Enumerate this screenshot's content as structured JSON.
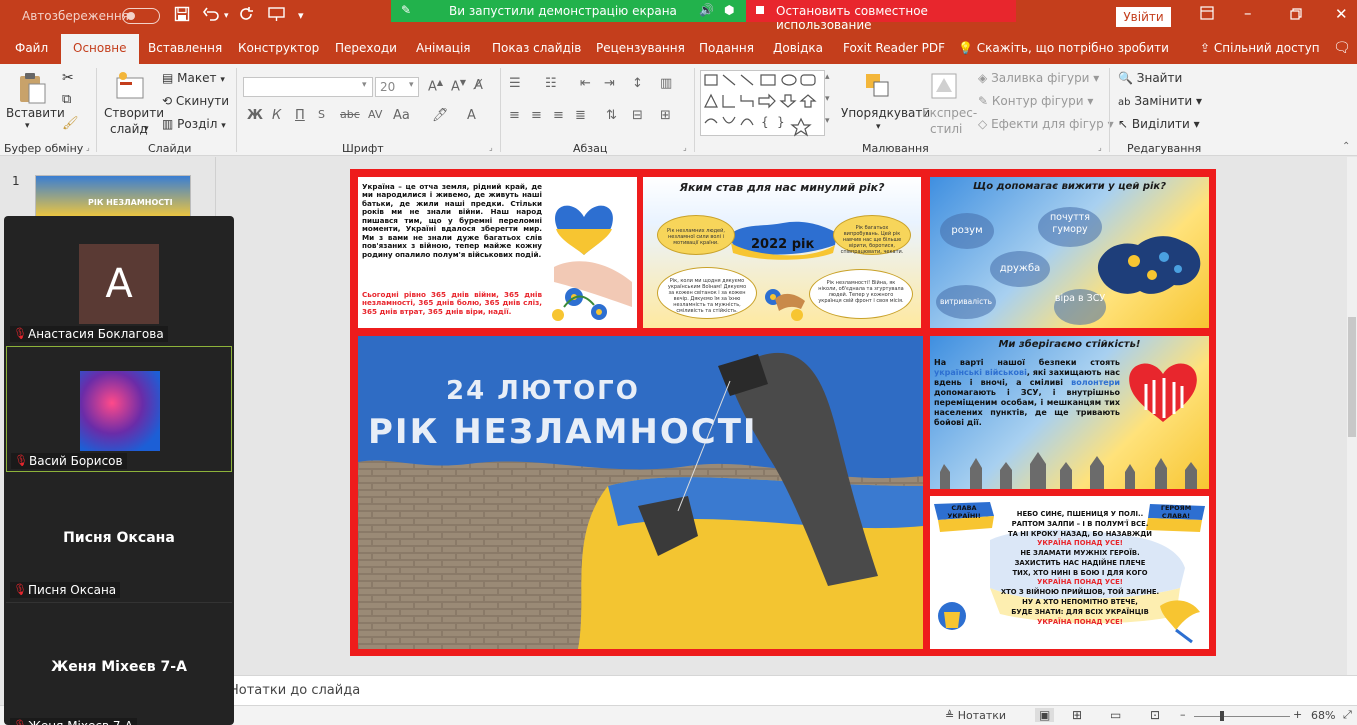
{
  "titlebar": {
    "autosave_label": "Автозбереження",
    "share_status": "Ви запустили демонстрацію екрана",
    "stop_share": "Остановить совместное использование",
    "sign_in": "Увійти"
  },
  "tabs": [
    "Файл",
    "Основне",
    "Вставлення",
    "Конструктор",
    "Переходи",
    "Анімація",
    "Показ слайдів",
    "Рецензування",
    "Подання",
    "Довідка",
    "Foxit Reader PDF"
  ],
  "active_tab": "Основне",
  "tell_me": "Скажіть, що потрібно зробити",
  "share_all": "Спільний доступ",
  "ribbon": {
    "clipboard": {
      "paste": "Вставити",
      "label": "Буфер обміну"
    },
    "slides": {
      "new_slide_1": "Створити",
      "new_slide_2": "слайд",
      "layout": "Макет",
      "reset": "Скинути",
      "section": "Розділ",
      "label": "Слайди"
    },
    "font": {
      "font_name": "",
      "font_size": "20",
      "label": "Шрифт"
    },
    "paragraph": {
      "label": "Абзац"
    },
    "drawing": {
      "arrange": "Упорядкувати",
      "quick_styles_1": "Експрес-",
      "quick_styles_2": "стилі",
      "fill": "Заливка фігури",
      "outline": "Контур фігури",
      "effects": "Ефекти для фігур",
      "label": "Малювання"
    },
    "editing": {
      "find": "Знайти",
      "replace": "Замінити",
      "select": "Виділити",
      "label": "Редагування"
    }
  },
  "thumbnails": {
    "slide_number": "1",
    "thumb_caption": "РІК НЕЗЛАМНОСТІ"
  },
  "participants": [
    {
      "name": "Анастасия Боклагова",
      "initial": "А"
    },
    {
      "name": "Васий Борисов"
    },
    {
      "name": "Писня Оксана"
    },
    {
      "name": "Женя Міхеєв 7-А"
    }
  ],
  "slide": {
    "p1_text_black": "Україна – це отча земля, рідний край, де ми народилися і живемо, де живуть наші батьки, де жили наші предки. Стільки років ми не знали війни. Наш народ пишався тим, що у буремні переломні моменти, Україні вдалося зберегти мир. Ми з вами не знали дуже багатьох слів пов'язаних з війною, тепер майже кожну родину опалило полум'я військових подій.",
    "p1_text_red": "Сьогодні рівно 365 днів війни, 365 днів незламності, 365 днів болю, 365 днів сліз, 365 днів втрат, 365 днів віри, надії.",
    "p2_title": "Яким став для нас минулий рік?",
    "p2_year": "2022 рік",
    "p2_bubbles": [
      "Рік незламних людей, незламної сили волі і мотивації країни.",
      "Рік багатьох випробувань. Цей рік навчив нас ще більше вірити, боротися, співпрацювати, чекати.",
      "Рік, коли ми щодня дякуємо українським Воїнам! Дякуємо за кожен світанок і за кожен вечір. Дякуємо їм за їхню незламність та мужність, сміливість та стійкість.",
      "Рік незламності! Війна, як ніколи, об'єднала та згуртувала людей. Тепер у кожного українця свій фронт і своя місія."
    ],
    "p3_title": "Що допомагає вижити у цей рік?",
    "p3_words": [
      "розум",
      "почуття гумору",
      "дружба",
      "витривалість",
      "віра в ЗСУ"
    ],
    "main_line1": "24 ЛЮТОГО",
    "main_line2": "РІК НЕЗЛАМНОСТІ",
    "p4_title": "Ми зберігаємо стійкість!",
    "p4_text_a": "На варті нашої безпеки стоять ",
    "p4_text_b": "українські військові",
    "p4_text_c": ", які захищають нас вдень і вночі, а сміливі ",
    "p4_text_d": "волонтери",
    "p4_text_e": " допомагають і ЗСУ, і внутрішньо переміщеним особам, і мешканцям тих населених пунктів, де ще тривають бойові дії.",
    "p5_flag_left": "СЛАВА УКРАЇНІ!",
    "p5_flag_right": "ГЕРОЯМ СЛАВА!",
    "p5_poem": [
      "НЕБО СИНЄ, ПШЕНИЦЯ У ПОЛІ..",
      "РАПТОМ ЗАЛПИ – І В ПОЛУМ'Ї ВСЕ.",
      "ТА НІ КРОКУ НАЗАД, БО НАЗАВЖДИ",
      "УКРАЇНА ПОНАД УСЕ!",
      "НЕ ЗЛАМАТИ МУЖНІХ ГЕРОЇВ.",
      "ЗАХИСТИТЬ НАС НАДІЙНЕ ПЛЕЧЕ",
      "ТИХ, ХТО НИНІ В БОЮ І ДЛЯ КОГО",
      "УКРАЇНА ПОНАД УСЕ!",
      "ХТО З ВІЙНОЮ ПРИЙШОВ, ТОЙ ЗАГИНЕ.",
      "НУ А ХТО НЕПОМІТНО ВТЕЧЕ,",
      "БУДЕ ЗНАТИ: ДЛЯ ВСІХ УКРАЇНЦІВ",
      "УКРАЇНА ПОНАД УСЕ!"
    ]
  },
  "notes_placeholder": "Нотатки до слайда",
  "status": {
    "notes": "Нотатки",
    "zoom": "68%"
  },
  "colors": {
    "accent": "#c43e1c",
    "share_green": "#22b24c",
    "share_red": "#e8262d",
    "slide_red": "#ee1c1c",
    "ukr_blue": "#2d6fd1",
    "ukr_yellow": "#f7c531"
  }
}
